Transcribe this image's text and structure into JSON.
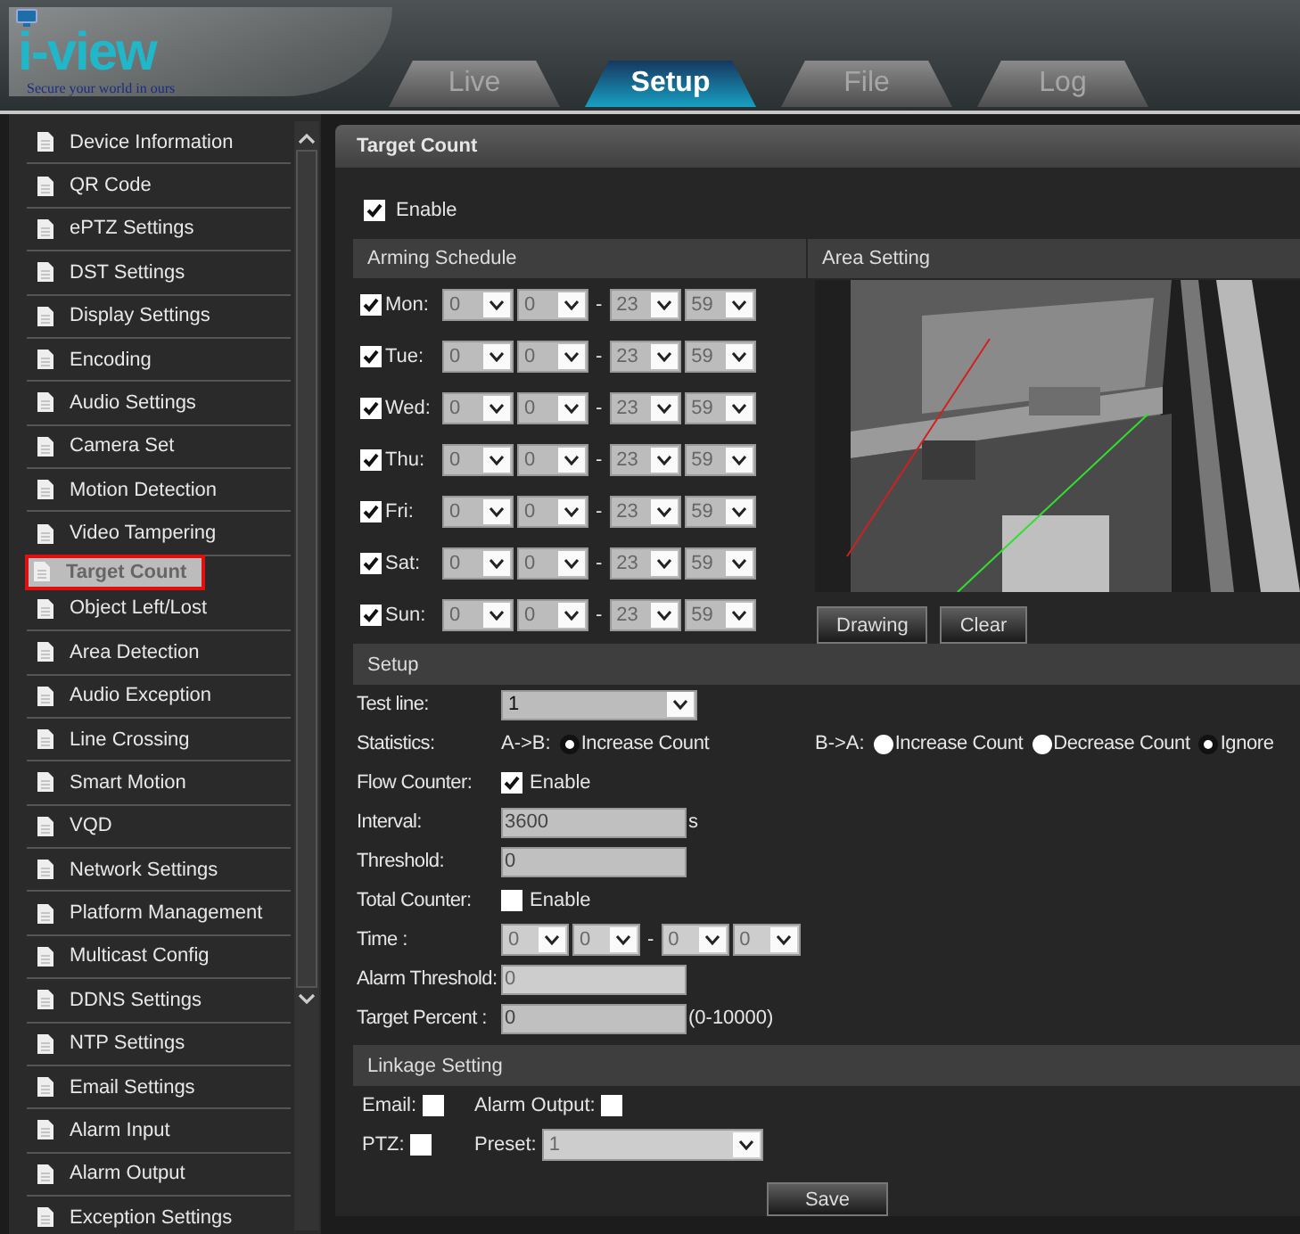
{
  "header": {
    "logo": {
      "name": "i-view",
      "tagline": "Secure your world in ours"
    },
    "tabs": [
      {
        "label": "Live",
        "selected": false
      },
      {
        "label": "Setup",
        "selected": true
      },
      {
        "label": "File",
        "selected": false
      },
      {
        "label": "Log",
        "selected": false
      }
    ]
  },
  "sidebar": {
    "items": [
      {
        "label": "Device Information",
        "selected": false
      },
      {
        "label": "QR Code",
        "selected": false
      },
      {
        "label": "ePTZ Settings",
        "selected": false
      },
      {
        "label": "DST Settings",
        "selected": false
      },
      {
        "label": "Display Settings",
        "selected": false
      },
      {
        "label": "Encoding",
        "selected": false
      },
      {
        "label": "Audio Settings",
        "selected": false
      },
      {
        "label": "Camera Set",
        "selected": false
      },
      {
        "label": "Motion Detection",
        "selected": false
      },
      {
        "label": "Video Tampering",
        "selected": false
      },
      {
        "label": "Target Count",
        "selected": true
      },
      {
        "label": "Object Left/Lost",
        "selected": false
      },
      {
        "label": "Area Detection",
        "selected": false
      },
      {
        "label": "Audio Exception",
        "selected": false
      },
      {
        "label": "Line Crossing",
        "selected": false
      },
      {
        "label": "Smart Motion",
        "selected": false
      },
      {
        "label": "VQD",
        "selected": false
      },
      {
        "label": "Network Settings",
        "selected": false
      },
      {
        "label": "Platform Management",
        "selected": false
      },
      {
        "label": "Multicast Config",
        "selected": false
      },
      {
        "label": "DDNS Settings",
        "selected": false
      },
      {
        "label": "NTP Settings",
        "selected": false
      },
      {
        "label": "Email Settings",
        "selected": false
      },
      {
        "label": "Alarm Input",
        "selected": false
      },
      {
        "label": "Alarm Output",
        "selected": false
      },
      {
        "label": "Exception Settings",
        "selected": false
      }
    ]
  },
  "panel": {
    "title": "Target Count",
    "enable": {
      "label": "Enable",
      "checked": true
    },
    "arming_schedule": {
      "title": "Arming Schedule",
      "separator": "-",
      "days": [
        {
          "label": "Mon:",
          "checked": true,
          "times": [
            "0",
            "0",
            "23",
            "59"
          ]
        },
        {
          "label": "Tue:",
          "checked": true,
          "times": [
            "0",
            "0",
            "23",
            "59"
          ]
        },
        {
          "label": "Wed:",
          "checked": true,
          "times": [
            "0",
            "0",
            "23",
            "59"
          ]
        },
        {
          "label": "Thu:",
          "checked": true,
          "times": [
            "0",
            "0",
            "23",
            "59"
          ]
        },
        {
          "label": "Fri:",
          "checked": true,
          "times": [
            "0",
            "0",
            "23",
            "59"
          ]
        },
        {
          "label": "Sat:",
          "checked": true,
          "times": [
            "0",
            "0",
            "23",
            "59"
          ]
        },
        {
          "label": "Sun:",
          "checked": true,
          "times": [
            "0",
            "0",
            "23",
            "59"
          ]
        }
      ]
    },
    "area_setting": {
      "title": "Area Setting",
      "buttons": [
        "Drawing",
        "Clear"
      ]
    },
    "setup": {
      "title": "Setup",
      "test_line": {
        "label": "Test line:",
        "value": "1"
      },
      "statistics": {
        "label": "Statistics:",
        "a_to_b": {
          "label": "A->B:",
          "options": [
            {
              "label": "Increase Count",
              "selected": true
            }
          ]
        },
        "b_to_a": {
          "label": "B->A:",
          "options": [
            {
              "label": "Increase Count",
              "selected": false
            },
            {
              "label": "Decrease Count",
              "selected": false
            },
            {
              "label": "Ignore",
              "selected": true
            }
          ]
        }
      },
      "flow_counter": {
        "label": "Flow Counter:",
        "checkbox_label": "Enable",
        "checked": true
      },
      "interval": {
        "label": "Interval:",
        "value": "3600",
        "unit": "s",
        "disabled": false
      },
      "threshold": {
        "label": "Threshold:",
        "value": "0",
        "disabled": false
      },
      "total_counter": {
        "label": "Total Counter:",
        "checkbox_label": "Enable",
        "checked": false
      },
      "time": {
        "label": "Time :",
        "values": [
          "0",
          "0",
          "0",
          "0"
        ],
        "separator": "-",
        "disabled": true
      },
      "alarm_threshold": {
        "label": "Alarm Threshold:",
        "value": "0",
        "disabled": true
      },
      "target_percent": {
        "label": "Target Percent :",
        "value": "0",
        "hint": "(0-10000)",
        "disabled": false
      }
    },
    "linkage": {
      "title": "Linkage Setting",
      "email": {
        "label": "Email:",
        "checked": false
      },
      "alarm_output": {
        "label": "Alarm Output:",
        "checked": false
      },
      "ptz": {
        "label": "PTZ:",
        "checked": false
      },
      "preset": {
        "label": "Preset:",
        "value": "1",
        "disabled": true
      }
    },
    "save_button": "Save"
  }
}
